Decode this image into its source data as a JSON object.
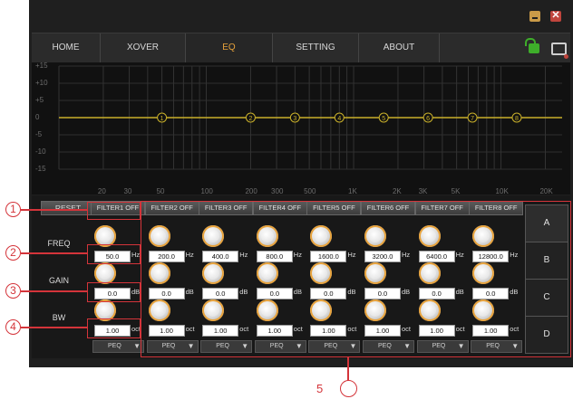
{
  "window": {
    "min_label": "",
    "close_label": "✕"
  },
  "menu": [
    {
      "label": "HOME"
    },
    {
      "label": "XOVER"
    },
    {
      "label": "EQ",
      "active": true
    },
    {
      "label": "SETTING"
    },
    {
      "label": "ABOUT"
    }
  ],
  "graph": {
    "y_labels": [
      "+15",
      "+10",
      "+5",
      "0",
      "-5",
      "-10",
      "-15"
    ],
    "x_labels": [
      "20",
      "30",
      "50",
      "100",
      "200",
      "300",
      "500",
      "1K",
      "2K",
      "3K",
      "5K",
      "10K",
      "20K"
    ],
    "markers": [
      "1",
      "2",
      "3",
      "4",
      "5",
      "6",
      "7",
      "8"
    ],
    "marker_color": "#c9b02a"
  },
  "panel": {
    "reset_label": "RESET",
    "freq_label": "FREQ",
    "gain_label": "GAIN",
    "bw_label": "BW",
    "units": {
      "freq": "Hz",
      "gain": "dB",
      "bw": "oct"
    },
    "filters": [
      {
        "title": "FILTER1 OFF",
        "freq": "50.0",
        "gain": "0.0",
        "bw": "1.00",
        "type": "PEQ"
      },
      {
        "title": "FILTER2 OFF",
        "freq": "200.0",
        "gain": "0.0",
        "bw": "1.00",
        "type": "PEQ"
      },
      {
        "title": "FILTER3 OFF",
        "freq": "400.0",
        "gain": "0.0",
        "bw": "1.00",
        "type": "PEQ"
      },
      {
        "title": "FILTER4 OFF",
        "freq": "800.0",
        "gain": "0.0",
        "bw": "1.00",
        "type": "PEQ"
      },
      {
        "title": "FILTER5 OFF",
        "freq": "1600.0",
        "gain": "0.0",
        "bw": "1.00",
        "type": "PEQ"
      },
      {
        "title": "FILTER6 OFF",
        "freq": "3200.0",
        "gain": "0.0",
        "bw": "1.00",
        "type": "PEQ"
      },
      {
        "title": "FILTER7 OFF",
        "freq": "6400.0",
        "gain": "0.0",
        "bw": "1.00",
        "type": "PEQ"
      },
      {
        "title": "FILTER8 OFF",
        "freq": "12800.0",
        "gain": "0.0",
        "bw": "1.00",
        "type": "PEQ"
      }
    ],
    "presets": [
      "A",
      "B",
      "C",
      "D"
    ]
  },
  "callouts": [
    "1",
    "2",
    "3",
    "4",
    "5"
  ],
  "accent_color": "#e8a33c",
  "annotation_color": "#d4343a"
}
